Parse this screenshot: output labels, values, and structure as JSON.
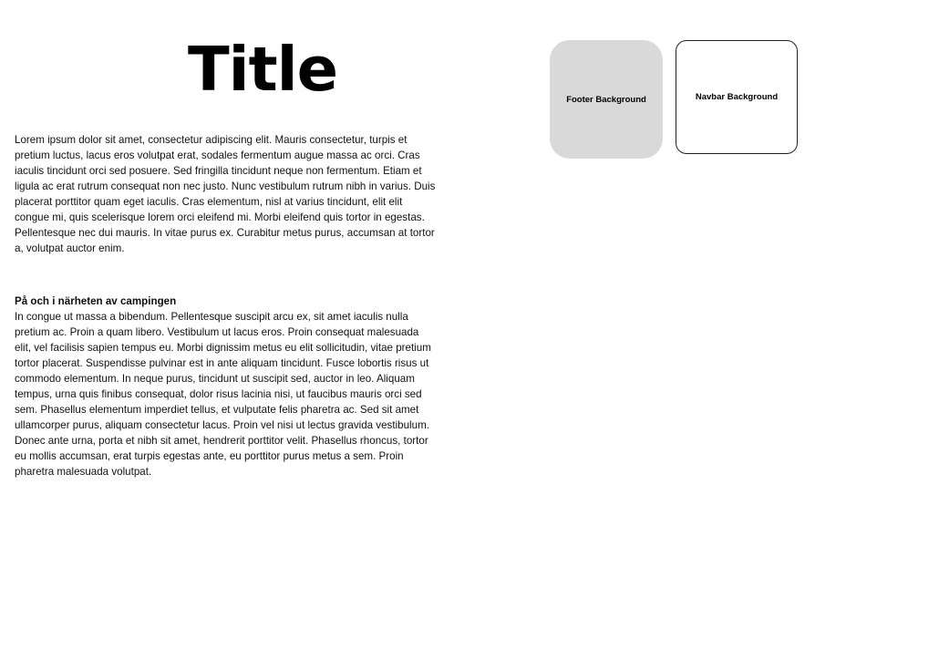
{
  "page": {
    "title": "Title",
    "intro_text": "Lorem ipsum dolor sit amet, consectetur adipiscing elit. Mauris consectetur, turpis et pretium luctus, lacus eros volutpat erat, sodales fermentum augue massa ac orci. Cras iaculis tincidunt orci sed posuere. Sed fringilla tincidunt neque non fermentum. Etiam et ligula ac erat rutrum consequat non nec justo. Nunc vestibulum rutrum nibh in varius. Duis placerat porttitor quam eget iaculis. Cras elementum, nisl at varius tincidunt, elit elit congue mi, quis scelerisque lorem orci eleifend mi. Morbi eleifend quis tortor in egestas. Pellentesque nec dui mauris. In vitae purus ex. Curabitur metus purus, accumsan at tortor a, volutpat auctor enim.",
    "section": {
      "heading": "På och i närheten av campingen",
      "text": "In congue ut massa a bibendum. Pellentesque suscipit arcu ex, sit amet iaculis nulla pretium ac. Proin a quam libero. Vestibulum ut lacus eros. Proin consequat malesuada elit, vel facilisis sapien tempus eu. Morbi dignissim metus eu elit sollicitudin, vitae pretium tortor placerat. Suspendisse pulvinar est in ante aliquam tincidunt. Fusce lobortis risus ut commodo elementum. In neque purus, tincidunt ut suscipit sed, auctor in leo. Aliquam tempus, urna quis finibus consequat, dolor risus lacinia nisi, ut faucibus mauris orci sed sem. Phasellus elementum imperdiet tellus, et vulputate felis pharetra ac. Sed sit amet ullamcorper purus, aliquam consectetur lacus. Proin vel nisi ut lectus gravida vestibulum. Donec ante urna, porta et nibh sit amet, hendrerit porttitor velit. Phasellus rhoncus, tortor eu mollis accumsan, erat turpis egestas ante, eu porttitor purus metus a sem. Proin pharetra malesuada volutpat."
    }
  },
  "swatches": {
    "footer": {
      "label": "Footer Background",
      "color": "#d9d9d9"
    },
    "navbar": {
      "label": "Navbar Background",
      "color": "#ffffff"
    }
  }
}
